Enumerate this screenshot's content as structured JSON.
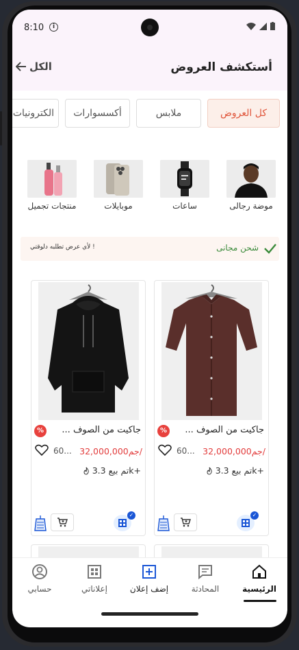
{
  "status_bar": {
    "time": "8:10",
    "icons": [
      "info-icon",
      "wifi-icon",
      "signal-icon",
      "battery-icon"
    ]
  },
  "header": {
    "title": "أستكشف العروض",
    "all_label": "الكل"
  },
  "chips": [
    {
      "label": "كل العروض",
      "active": true
    },
    {
      "label": "ملابس",
      "active": false
    },
    {
      "label": "أكسسوارات",
      "active": false
    },
    {
      "label": "الكترونيات",
      "active": false
    }
  ],
  "categories": [
    {
      "label": "موضة رجالى",
      "icon": "man-photo"
    },
    {
      "label": "ساعات",
      "icon": "watch-photo"
    },
    {
      "label": "موبايلات",
      "icon": "phone-photo"
    },
    {
      "label": "منتجات تجميل",
      "icon": "cosmetics-photo"
    }
  ],
  "banner": {
    "shipping": "شحن مجانى",
    "note": "لأي عرض تطلبه دلوقتي !"
  },
  "products": [
    {
      "name": "جاكيت من الصوف ...",
      "price": "32,000,000جم/",
      "old_price": "60...",
      "sold": "تم بيع 3.3k+",
      "image": "brown-shirt"
    },
    {
      "name": "جاكيت من الصوف ...",
      "price": "32,000,000جم/",
      "old_price": "60...",
      "sold": "تم بيع 3.3k+",
      "image": "black-hoodie"
    }
  ],
  "bottom_nav": [
    {
      "label": "الرئيسية",
      "icon": "home-icon",
      "active": true
    },
    {
      "label": "المحادثة",
      "icon": "chat-icon",
      "active": false
    },
    {
      "label": "إضف إعلان",
      "icon": "add-icon",
      "active": false
    },
    {
      "label": "إعلاناتي",
      "icon": "grid-icon",
      "active": false
    },
    {
      "label": "حسابي",
      "icon": "profile-icon",
      "active": false
    }
  ],
  "colors": {
    "accent": "#e0553a",
    "price": "#e23b3b",
    "shipping": "#3a8a3a",
    "verify": "#1a56d6",
    "header_bg": "#fbf3fb"
  }
}
